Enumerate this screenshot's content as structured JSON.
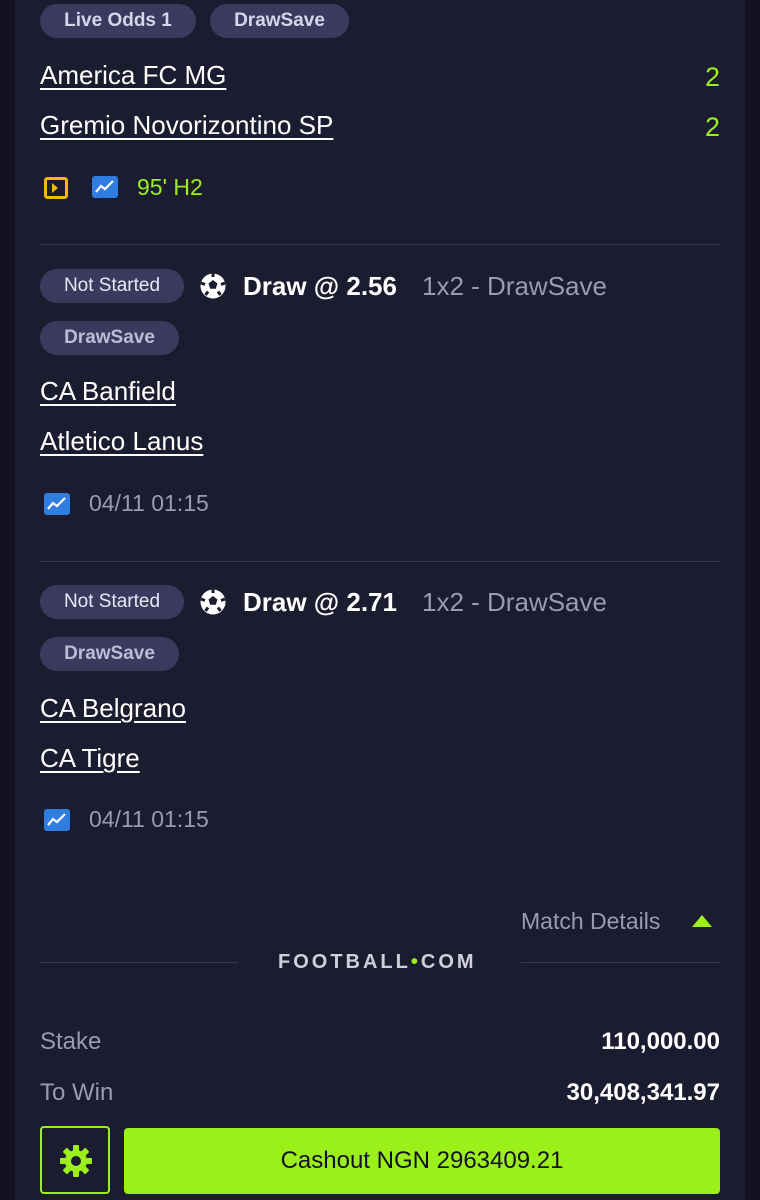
{
  "colors": {
    "accent": "#9cf01a",
    "card": "#1c1c30",
    "pill": "#3a3a5e",
    "muted": "#9a9ab0"
  },
  "top": {
    "tags": [
      "Live Odds 1",
      "DrawSave"
    ],
    "teams": [
      {
        "name": "America FC MG",
        "score": "2"
      },
      {
        "name": "Gremio Novorizontino SP",
        "score": "2"
      }
    ],
    "icons": [
      "live-stream-icon",
      "stats-chart-icon"
    ],
    "time": "95' H2"
  },
  "selections": [
    {
      "status": "Not Started",
      "pick": "Draw @ 2.56",
      "market": "1x2 - DrawSave",
      "tag": "DrawSave",
      "teams": [
        "CA Banfield",
        "Atletico Lanus"
      ],
      "kickoff": "04/11 01:15"
    },
    {
      "status": "Not Started",
      "pick": "Draw @ 2.71",
      "market": "1x2 - DrawSave",
      "tag": "DrawSave",
      "teams": [
        "CA Belgrano",
        "CA Tigre"
      ],
      "kickoff": "04/11 01:15"
    }
  ],
  "match_details_label": "Match Details",
  "brand": {
    "text": "FOOTBALL",
    "dot": "•",
    "suffix": "COM"
  },
  "summary": {
    "stake_label": "Stake",
    "stake_value": "110,000.00",
    "to_win_label": "To Win",
    "to_win_value": "30,408,341.97"
  },
  "cashout_label": "Cashout NGN 2963409.21"
}
